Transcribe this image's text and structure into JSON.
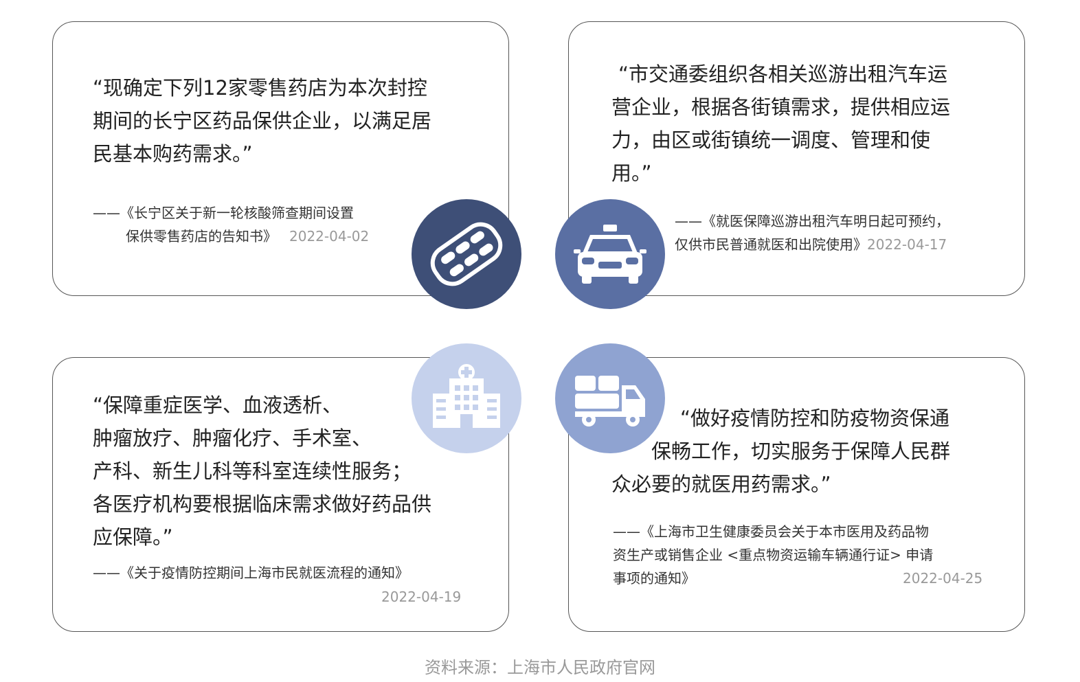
{
  "cards": [
    {
      "quote_lines": [
        "“现确定下列12家零售药店为本次封控",
        "期间的长宁区药品保供企业，以满足居",
        "民基本购药需求。”"
      ],
      "source_lines": [
        "——《长宁区关于新一轮核酸筛查期间设置",
        "保供零售药店的告知书》"
      ],
      "date": "2022-04-02",
      "icon": "pill-blister-icon"
    },
    {
      "quote_lines": [
        "“市交通委组织各相关巡游出租汽车运",
        "营企业，根据各街镇需求，提供相应运",
        "力，由区或街镇统一调度、管理和使",
        "用。”"
      ],
      "source_lines": [
        "——《就医保障巡游出租汽车明日起可预约，",
        "仅供市民普通就医和出院使用》"
      ],
      "date": "2022-04-17",
      "icon": "taxi-icon"
    },
    {
      "quote_lines": [
        "“保障重症医学、血液透析、",
        "肿瘤放疗、肿瘤化疗、手术室、",
        "产科、新生儿科等科室连续性服务；",
        "各医疗机构要根据临床需求做好药品供",
        "应保障。”"
      ],
      "source_lines": [
        "——《关于疫情防控期间上海市民就医流程的通知》"
      ],
      "date": "2022-04-19",
      "icon": "hospital-icon"
    },
    {
      "quote_lines": [
        "“做好疫情防控和防疫物资保通",
        "保畅工作，切实服务于保障人民群",
        "众必要的就医用药需求。”"
      ],
      "source_lines": [
        "——《上海市卫生健康委员会关于本市医用及药品物",
        "资生产或销售企业 <重点物资运输车辆通行证> 申请",
        "事项的通知》"
      ],
      "date": "2022-04-25",
      "icon": "delivery-truck-icon"
    }
  ],
  "colors": {
    "circle_dark": "#3e4f77",
    "circle_mid": "#5a6fa3",
    "circle_light": "#c5d1ec",
    "circle_soft": "#8fa3d1"
  },
  "footer": "资料来源：上海市人民政府官网"
}
